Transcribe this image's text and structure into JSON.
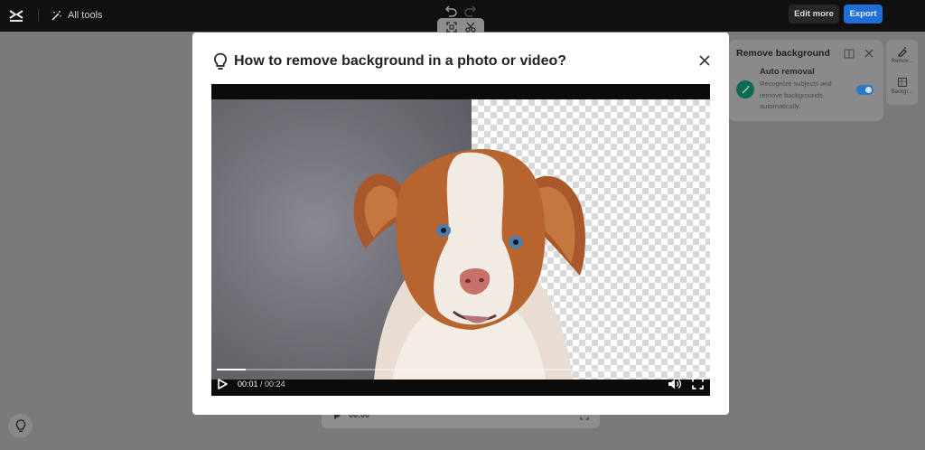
{
  "app": {
    "logo_icon": "capcut-logo-icon",
    "all_tools_label": "All tools",
    "edit_more_label": "Edit more",
    "export_label": "Export",
    "accent_color": "#1f6fd6"
  },
  "panel": {
    "title": "Remove background",
    "auto_removal_title": "Auto removal",
    "auto_removal_desc": "Recognize subjects and remove backgrounds automatically.",
    "auto_removal_enabled": true,
    "rail_items": [
      "Remov...",
      "Backgr..."
    ]
  },
  "modal": {
    "title": "How to remove background in a photo or video?",
    "icon": "lightbulb-icon",
    "close_icon": "close-icon"
  },
  "video": {
    "current_time": "00:01",
    "separator": " / ",
    "duration": "00:24",
    "progress_fraction": 0.06,
    "play_icon": "play-icon",
    "volume_icon": "volume-icon",
    "fullscreen_icon": "fullscreen-icon"
  },
  "player_strip": {
    "current_time": "00:00"
  }
}
